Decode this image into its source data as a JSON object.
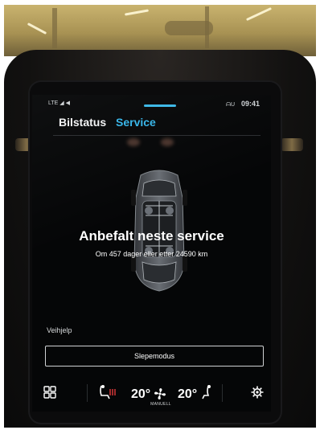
{
  "status_bar": {
    "left": "LTE ◢ ◀",
    "right": "ᗩU",
    "clock": "09:41"
  },
  "tabs": [
    {
      "label": "Bilstatus",
      "active": false
    },
    {
      "label": "Service",
      "active": true
    }
  ],
  "service": {
    "headline": "Anbefalt neste service",
    "detail": "Om 457 dager eller etter 24590 km"
  },
  "assistance": {
    "section_label": "Veihjelp",
    "tow_mode_button": "Slepemodus"
  },
  "climate": {
    "left_temp": "20°",
    "right_temp": "20°",
    "fan_mode": "MANUELL"
  },
  "icons": {
    "home": "grid-icon",
    "seat_heat_left": "seat-heat-icon",
    "fan": "fan-icon",
    "seat_right": "seat-icon",
    "settings": "gear-icon"
  },
  "colors": {
    "accent": "#35b5e9",
    "screen_bg": "#050607",
    "text": "#ffffff"
  }
}
